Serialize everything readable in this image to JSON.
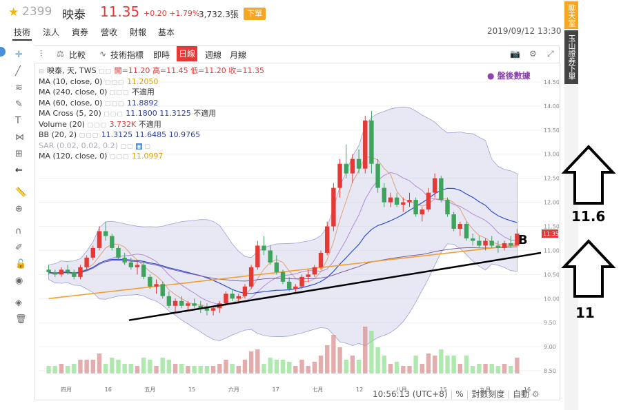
{
  "header": {
    "code": "2399",
    "name": "映泰",
    "price": "11.35",
    "change": "+0.20",
    "change_pct": "+1.79%",
    "volume": "3,732.3張",
    "order_button": "下單",
    "datetime": "2019/09/12 13:30",
    "tabs": [
      "技術",
      "法人",
      "資券",
      "營收",
      "財報",
      "基本"
    ]
  },
  "toolbar": {
    "compare": "比較",
    "indicators": "技術指標",
    "realtime": "即時",
    "day": "日線",
    "week": "週線",
    "month": "月線"
  },
  "legend": {
    "l1_label": "映泰, 天, TWS",
    "l1_open": "開=11.20",
    "l1_high": "高=11.45",
    "l1_low": "低=11.20",
    "l1_close": "收=11.35",
    "ma10": "MA (10, close, 0)",
    "ma10_val": "11.2050",
    "ma240": "MA (240, close, 0)",
    "ma240_val": "不適用",
    "ma60": "MA (60, close, 0)",
    "ma60_val": "11.8892",
    "macross": "MA Cross (5, 20)",
    "macross_v1": "11.1800",
    "macross_v2": "11.3125",
    "macross_v3": "不適用",
    "volume": "Volume (20)",
    "volume_v1": "3.732K",
    "volume_v2": "不適用",
    "bb": "BB (20, 2)",
    "bb_v1": "11.3125",
    "bb_v2": "11.6485",
    "bb_v3": "10.9765",
    "sar": "SAR (0.02, 0.02, 0.2)",
    "ma120": "MA (120, close, 0)",
    "ma120_val": "11.0997"
  },
  "after_hours": "盤後數據",
  "status": {
    "time": "10:56:13 (UTC+8)",
    "pct": "%",
    "log": "對數刻度",
    "auto": "自動"
  },
  "sidebar_right": {
    "chat": "聊天室",
    "yushan": "玉山證券下單"
  },
  "annotations": {
    "b": "B",
    "upper": "11.6",
    "lower": "11"
  },
  "chart_data": {
    "type": "candlestick",
    "y_ticks": [
      "14.50",
      "14.00",
      "13.50",
      "13.00",
      "12.50",
      "12.00",
      "11.50",
      "11.00",
      "10.50",
      "10.00",
      "9.50",
      "9.00",
      "8.50"
    ],
    "x_ticks": [
      "四月",
      "16",
      "五月",
      "15",
      "六月",
      "17",
      "七月",
      "12",
      "八月",
      "15",
      "九月",
      "16"
    ],
    "last_price_label": "11.35",
    "ylim": [
      8.3,
      14.6
    ],
    "candles": [
      [
        10.6,
        10.7,
        10.5,
        10.55
      ],
      [
        10.55,
        10.6,
        10.45,
        10.5
      ],
      [
        10.5,
        10.65,
        10.45,
        10.6
      ],
      [
        10.6,
        10.7,
        10.5,
        10.55
      ],
      [
        10.55,
        10.6,
        10.4,
        10.45
      ],
      [
        10.45,
        10.7,
        10.4,
        10.65
      ],
      [
        10.65,
        10.9,
        10.6,
        10.85
      ],
      [
        10.85,
        11.1,
        10.8,
        11.05
      ],
      [
        11.05,
        11.5,
        11.0,
        11.4
      ],
      [
        11.4,
        11.6,
        11.2,
        11.3
      ],
      [
        11.3,
        11.35,
        11.0,
        11.05
      ],
      [
        11.05,
        11.1,
        10.8,
        10.85
      ],
      [
        10.85,
        10.95,
        10.7,
        10.75
      ],
      [
        10.75,
        10.85,
        10.6,
        10.65
      ],
      [
        10.65,
        10.8,
        10.5,
        10.7
      ],
      [
        10.7,
        10.75,
        10.4,
        10.45
      ],
      [
        10.45,
        10.5,
        10.2,
        10.25
      ],
      [
        10.25,
        10.4,
        10.1,
        10.3
      ],
      [
        10.3,
        10.35,
        10.0,
        10.05
      ],
      [
        10.05,
        10.15,
        9.8,
        9.85
      ],
      [
        9.85,
        10.0,
        9.7,
        9.95
      ],
      [
        9.95,
        10.05,
        9.8,
        9.85
      ],
      [
        9.85,
        9.95,
        9.75,
        9.9
      ],
      [
        9.9,
        10.0,
        9.8,
        9.85
      ],
      [
        9.85,
        9.95,
        9.7,
        9.8
      ],
      [
        9.8,
        9.9,
        9.65,
        9.75
      ],
      [
        9.75,
        9.85,
        9.65,
        9.8
      ],
      [
        9.8,
        9.95,
        9.7,
        9.9
      ],
      [
        9.9,
        10.15,
        9.85,
        10.1
      ],
      [
        10.1,
        10.2,
        9.95,
        10.0
      ],
      [
        10.0,
        10.1,
        9.9,
        10.05
      ],
      [
        10.05,
        10.3,
        10.0,
        10.25
      ],
      [
        10.25,
        10.7,
        10.2,
        10.65
      ],
      [
        10.65,
        11.2,
        10.6,
        11.1
      ],
      [
        11.1,
        11.3,
        10.9,
        11.0
      ],
      [
        11.0,
        11.1,
        10.7,
        10.75
      ],
      [
        10.75,
        10.9,
        10.5,
        10.55
      ],
      [
        10.55,
        10.6,
        10.3,
        10.35
      ],
      [
        10.35,
        10.45,
        10.15,
        10.2
      ],
      [
        10.2,
        10.3,
        10.1,
        10.25
      ],
      [
        10.25,
        10.5,
        10.2,
        10.45
      ],
      [
        10.45,
        10.6,
        10.35,
        10.5
      ],
      [
        10.5,
        10.7,
        10.45,
        10.65
      ],
      [
        10.65,
        11.0,
        10.6,
        10.95
      ],
      [
        10.95,
        11.6,
        10.9,
        11.5
      ],
      [
        11.5,
        12.4,
        11.4,
        12.3
      ],
      [
        12.3,
        12.9,
        12.1,
        12.8
      ],
      [
        12.8,
        13.2,
        12.5,
        12.6
      ],
      [
        12.6,
        13.0,
        12.4,
        12.9
      ],
      [
        12.9,
        13.1,
        12.6,
        12.7
      ],
      [
        12.7,
        13.8,
        12.6,
        13.7
      ],
      [
        13.7,
        13.9,
        12.6,
        12.8
      ],
      [
        12.8,
        12.9,
        12.2,
        12.3
      ],
      [
        12.3,
        12.4,
        11.9,
        12.0
      ],
      [
        12.0,
        12.2,
        11.9,
        12.1
      ],
      [
        12.1,
        12.2,
        11.9,
        11.95
      ],
      [
        11.95,
        12.1,
        11.8,
        12.0
      ],
      [
        12.0,
        12.2,
        11.9,
        12.05
      ],
      [
        12.05,
        12.1,
        11.7,
        11.75
      ],
      [
        11.75,
        11.9,
        11.6,
        11.85
      ],
      [
        11.85,
        12.3,
        11.8,
        12.2
      ],
      [
        12.2,
        12.6,
        12.1,
        12.5
      ],
      [
        12.5,
        12.55,
        12.0,
        12.05
      ],
      [
        12.05,
        12.1,
        11.7,
        11.75
      ],
      [
        11.75,
        11.8,
        11.4,
        11.45
      ],
      [
        11.45,
        11.6,
        11.3,
        11.55
      ],
      [
        11.55,
        11.6,
        11.2,
        11.25
      ],
      [
        11.25,
        11.35,
        11.1,
        11.2
      ],
      [
        11.2,
        11.3,
        11.05,
        11.1
      ],
      [
        11.1,
        11.25,
        11.0,
        11.2
      ],
      [
        11.2,
        11.3,
        11.05,
        11.1
      ],
      [
        11.1,
        11.2,
        10.95,
        11.05
      ],
      [
        11.05,
        11.2,
        11.0,
        11.15
      ],
      [
        11.15,
        11.3,
        11.05,
        11.1
      ],
      [
        11.1,
        11.45,
        11.1,
        11.35
      ]
    ],
    "trendline": {
      "from": [
        0.18,
        9.55
      ],
      "to": [
        1.0,
        10.95
      ]
    }
  }
}
